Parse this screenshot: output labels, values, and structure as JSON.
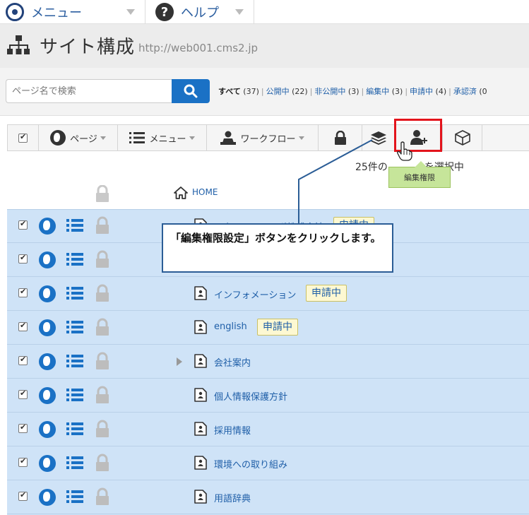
{
  "nav": {
    "menu_label": "メニュー",
    "help_label": "ヘルプ"
  },
  "header": {
    "title": "サイト構成",
    "url": "http://web001.cms2.jp"
  },
  "search": {
    "placeholder": "ページ名で検索"
  },
  "filters": {
    "all": "すべて",
    "all_count": "(37)",
    "items": [
      {
        "label": "公開中",
        "count": "(22)"
      },
      {
        "label": "非公開中",
        "count": "(3)"
      },
      {
        "label": "編集中",
        "count": "(3)"
      },
      {
        "label": "申請中",
        "count": "(4)"
      },
      {
        "label": "承認済",
        "count": "(0"
      }
    ]
  },
  "toolbar": {
    "page_label": "ページ",
    "menu_label": "メニュー",
    "workflow_label": "ワークフロー"
  },
  "list": {
    "count_text": "25件の",
    "count_suffix": "を選択中",
    "home_label": "HOME",
    "badge_label": "申請中",
    "rows": [
      {
        "label": "スターティアラボ株式会社",
        "badge": true
      },
      {
        "label": "",
        "badge": false
      },
      {
        "label": "インフォメーション",
        "badge": true
      },
      {
        "label": "english",
        "badge": true
      },
      {
        "label": "会社案内",
        "badge": false,
        "expandable": true
      },
      {
        "label": "個人情報保護方針",
        "badge": false
      },
      {
        "label": "採用情報",
        "badge": false
      },
      {
        "label": "環境への取り組み",
        "badge": false
      },
      {
        "label": "用語辞典",
        "badge": false
      }
    ]
  },
  "tooltip": {
    "label": "編集権限"
  },
  "callout": {
    "text": "「編集権限設定」ボタンをクリックします。"
  },
  "colors": {
    "accent": "#1a71c5",
    "selected_row": "#cfe3f7",
    "highlight": "#e3141c",
    "callout_border": "#2b5d96",
    "tooltip": "#c6e59a"
  }
}
